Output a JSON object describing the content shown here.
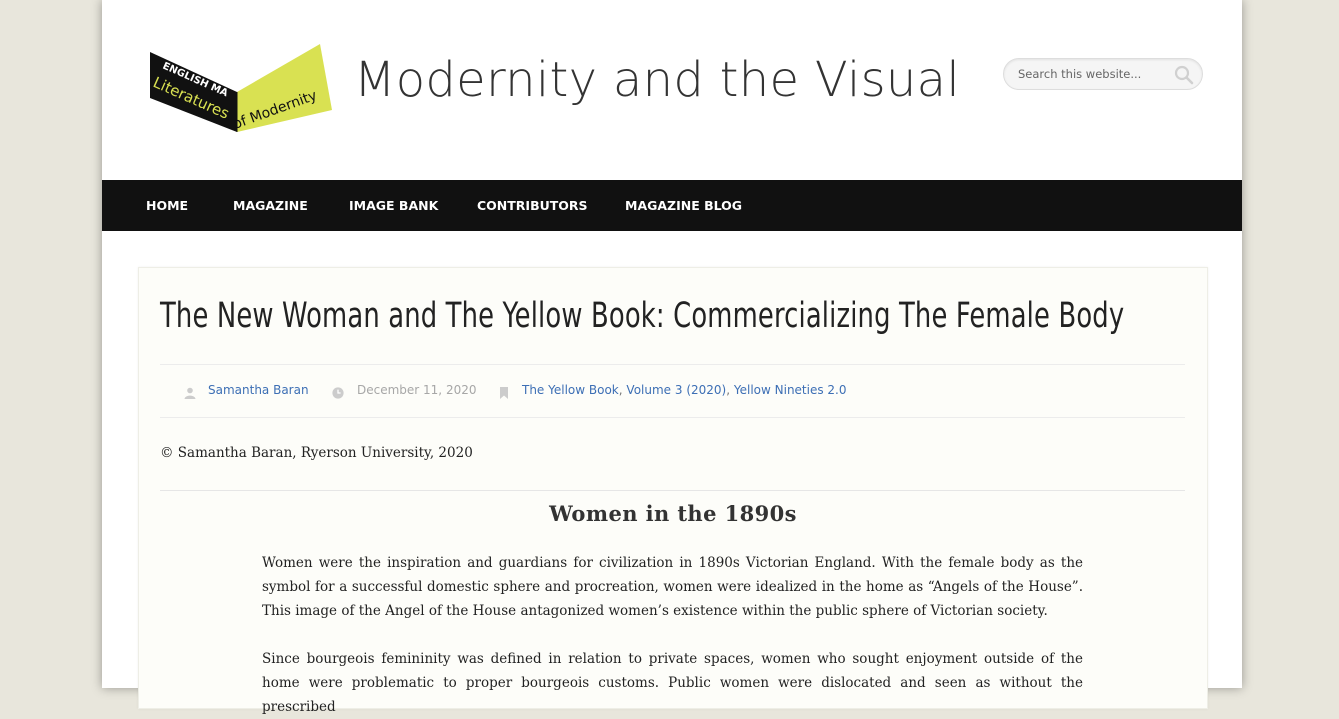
{
  "logo": {
    "line1": "ENGLISH MA",
    "line2": "Literatures",
    "line3": "of Modernity",
    "colors": {
      "black_panel": "#111111",
      "yellow_panel": "#d9e152"
    }
  },
  "header": {
    "site_title": "Modernity and the Visual",
    "search_placeholder": "Search this website...",
    "search_icon": "magnifier-icon"
  },
  "nav": {
    "items": [
      {
        "label": "HOME"
      },
      {
        "label": "MAGAZINE"
      },
      {
        "label": "IMAGE BANK"
      },
      {
        "label": "CONTRIBUTORS"
      },
      {
        "label": "MAGAZINE BLOG"
      }
    ]
  },
  "post": {
    "title": "The New Woman and The Yellow Book: Commercializing The Female Body",
    "author": "Samantha Baran",
    "date": "December 11, 2020",
    "categories": [
      {
        "label": "The Yellow Book"
      },
      {
        "label": "Volume 3 (2020)"
      },
      {
        "label": "Yellow Nineties 2.0"
      }
    ],
    "category_separator": ",",
    "copyright": "© Samantha Baran, Ryerson University, 2020",
    "section_heading": "Women in the 1890s",
    "paragraphs": [
      "Women were the inspiration and guardians for civilization in 1890s Victorian England. With the female body as the symbol for a successful domestic sphere and procreation, women were idealized in the home as “Angels of the House”. This image of the Angel of the House antagonized women’s existence within the public sphere of Victorian society.",
      "Since bourgeois femininity was defined in relation to private spaces, women who sought enjoyment outside of the home were problematic to proper bourgeois customs. Public women were dislocated and seen as without the prescribed"
    ]
  },
  "colors": {
    "nav_bg": "#111111",
    "link": "#3d6fb5",
    "page_bg": "#e8e6dc",
    "content_bg": "#fdfdf9"
  }
}
